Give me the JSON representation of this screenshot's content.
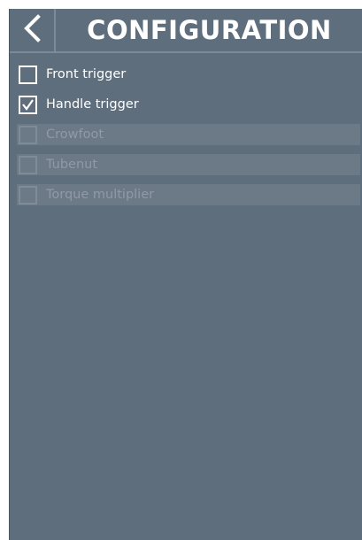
{
  "header": {
    "title": "CONFIGURATION",
    "back_icon": "chevron-left-icon"
  },
  "options": [
    {
      "label": "Front trigger",
      "checked": false,
      "enabled": true
    },
    {
      "label": "Handle trigger",
      "checked": true,
      "enabled": true
    },
    {
      "label": "Crowfoot",
      "checked": false,
      "enabled": false
    },
    {
      "label": "Tubenut",
      "checked": false,
      "enabled": false
    },
    {
      "label": "Torque multiplier",
      "checked": false,
      "enabled": false
    }
  ],
  "colors": {
    "background": "#5f6e7d",
    "divider": "#7d8b98",
    "text": "#ffffff",
    "disabled_row": "#6c7986",
    "disabled_text": "#8f9aa5"
  }
}
